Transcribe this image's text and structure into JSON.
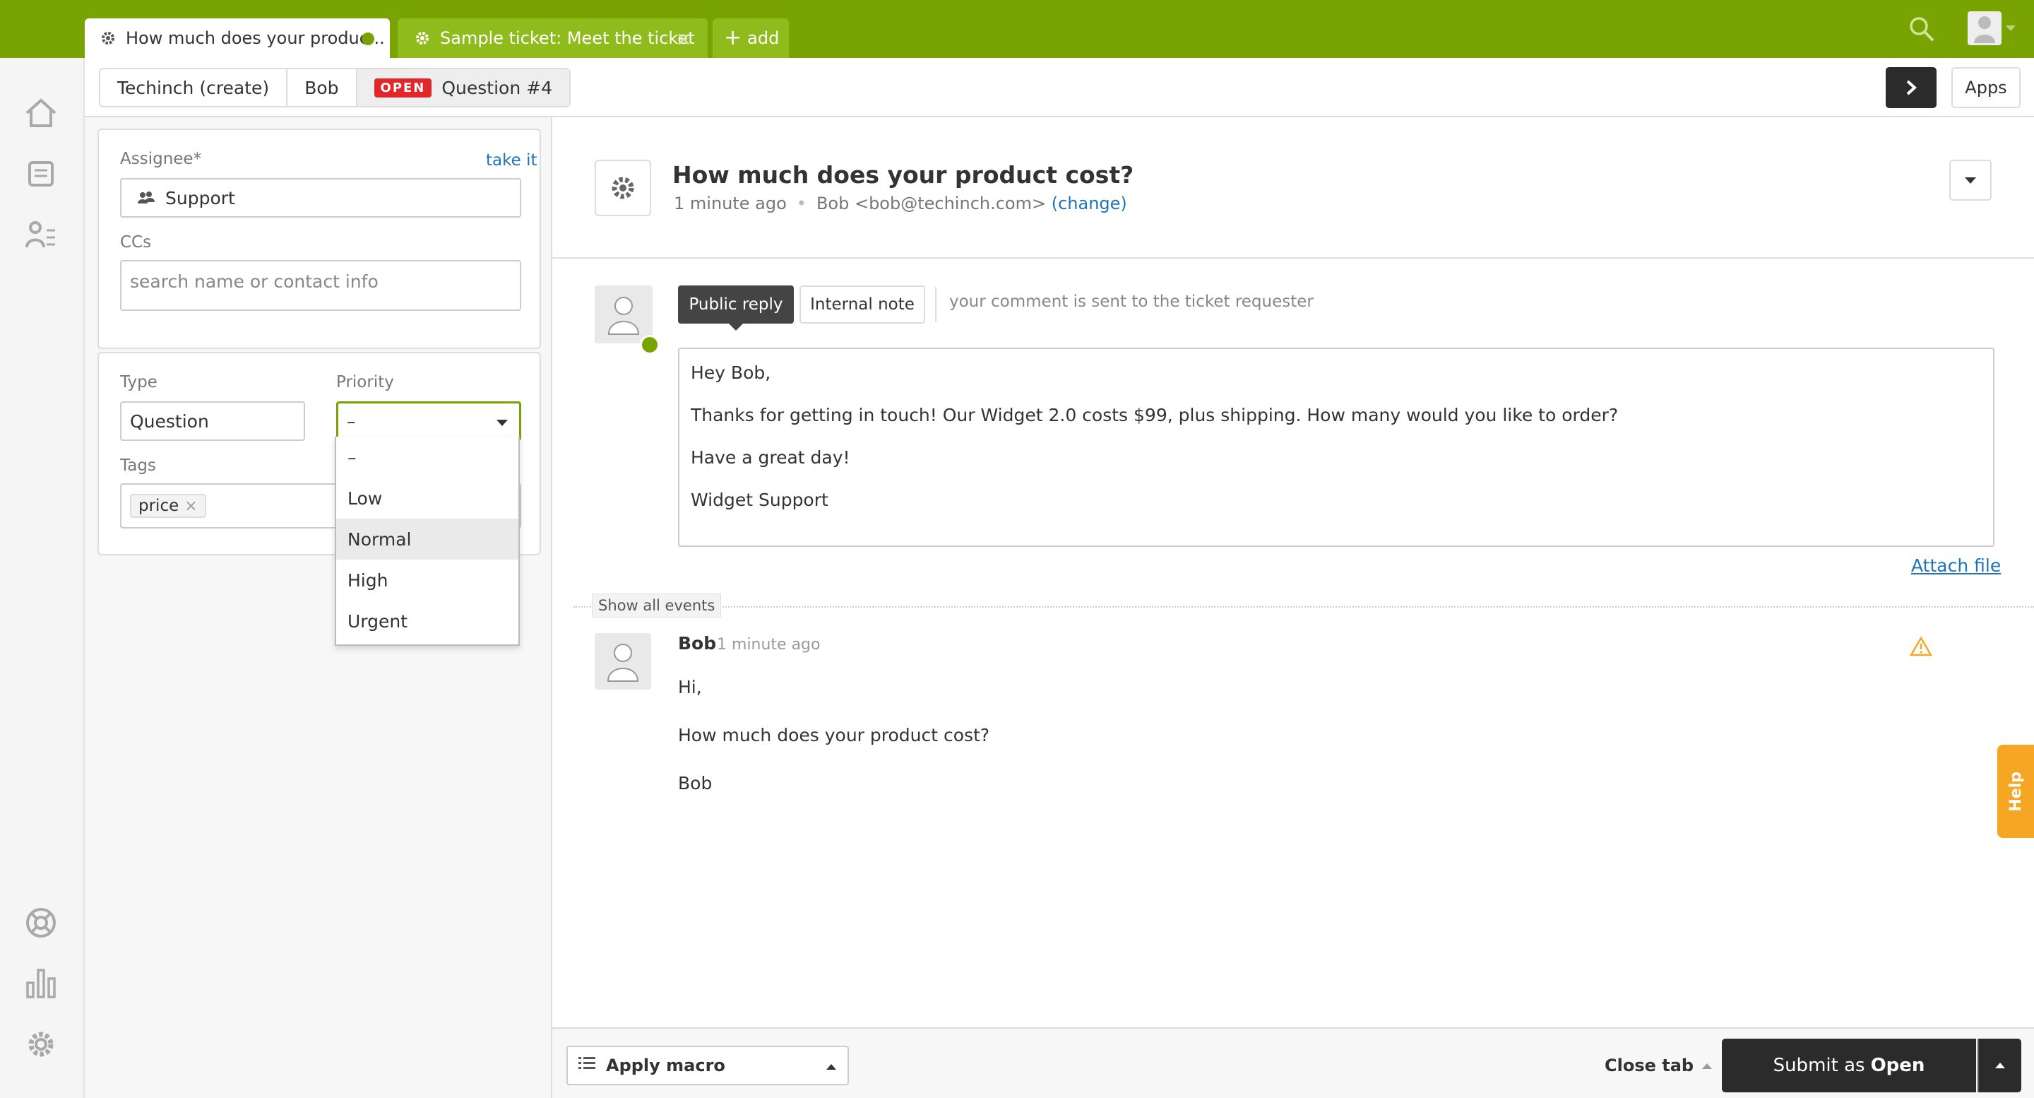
{
  "colors": {
    "brand": "#78a300",
    "open_badge": "#e3262a",
    "link": "#1f73b7",
    "help": "#f5a623"
  },
  "tabs": [
    {
      "label": "How much does your produc...",
      "icon": "gear-icon",
      "status": "online-dot"
    },
    {
      "label": "Sample ticket: Meet the ticket",
      "icon": "gear-icon",
      "close": "×"
    },
    {
      "label": "add",
      "icon": "plus-icon"
    }
  ],
  "breadcrumb": {
    "org": "Techinch (create)",
    "requester": "Bob",
    "status_badge": "OPEN",
    "ticket": "Question #4"
  },
  "header": {
    "apps_label": "Apps"
  },
  "props": {
    "assignee_label": "Assignee*",
    "take_it": "take it",
    "assignee_value": "Support",
    "ccs_label": "CCs",
    "ccs_placeholder": "search name or contact info",
    "type_label": "Type",
    "type_value": "Question",
    "priority_label": "Priority",
    "priority_value": "–",
    "tags_label": "Tags",
    "tags": [
      "price"
    ],
    "tag_remove": "×",
    "priority_options": [
      "–",
      "Low",
      "Normal",
      "High",
      "Urgent"
    ],
    "priority_highlighted": "Normal"
  },
  "ticket": {
    "title": "How much does your product cost?",
    "time": "1 minute ago",
    "requester": "Bob <bob@techinch.com>",
    "change": "(change)"
  },
  "reply": {
    "public_label": "Public reply",
    "internal_label": "Internal note",
    "hint": "your comment is sent to the ticket requester",
    "body": [
      "Hey Bob,",
      "Thanks for getting in touch! Our Widget 2.0 costs $99, plus shipping. How many would you like to order?",
      "Have a great day!",
      "Widget Support"
    ],
    "attach": "Attach file"
  },
  "events": {
    "show_all": "Show all events"
  },
  "message": {
    "author": "Bob",
    "time": "1 minute ago",
    "lines": [
      "Hi,",
      "How much does your product cost?",
      "Bob"
    ]
  },
  "help_label": "Help",
  "footer": {
    "macro": "Apply macro",
    "close_tab": "Close tab",
    "submit_prefix": "Submit as",
    "submit_status": "Open"
  }
}
